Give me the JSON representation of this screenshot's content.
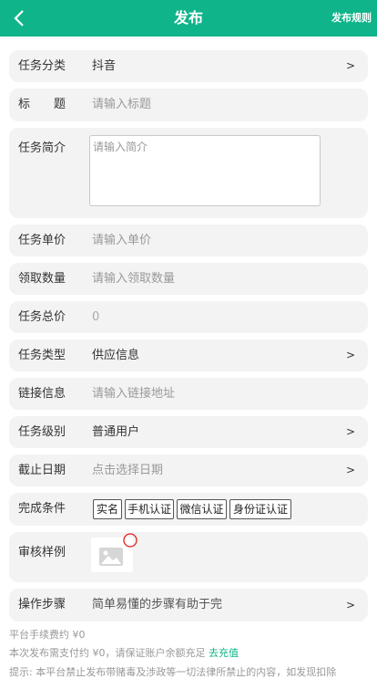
{
  "header": {
    "title": "发布",
    "rules_label": "发布规则"
  },
  "form": {
    "category": {
      "label": "任务分类",
      "value": "抖音",
      "arrow": ">"
    },
    "title": {
      "label": "标　　题",
      "placeholder": "请输入标题"
    },
    "intro": {
      "label": "任务简介",
      "placeholder": "请输入简介"
    },
    "unit_price": {
      "label": "任务单价",
      "placeholder": "请输入单价"
    },
    "quantity": {
      "label": "领取数量",
      "placeholder": "请输入领取数量"
    },
    "total": {
      "label": "任务总价",
      "value": "0"
    },
    "type": {
      "label": "任务类型",
      "value": "供应信息",
      "arrow": ">"
    },
    "link": {
      "label": "链接信息",
      "placeholder": "请输入链接地址"
    },
    "level": {
      "label": "任务级别",
      "value": "普通用户",
      "arrow": ">"
    },
    "deadline": {
      "label": "截止日期",
      "placeholder": "点击选择日期",
      "arrow": ">"
    },
    "conditions": {
      "label": "完成条件",
      "tags": [
        "实名",
        "手机认证",
        "微信认证",
        "身份证认证"
      ]
    },
    "sample": {
      "label": "审核样例"
    },
    "steps": {
      "label": "操作步骤",
      "placeholder": "简单易懂的步骤有助于完",
      "arrow": ">"
    }
  },
  "footer": {
    "fee": "平台手续费约 ¥0",
    "pay_text": "本次发布需支付约 ¥0，请保证账户余额充足 ",
    "recharge_link": "去充值",
    "tip": "提示: 本平台禁止发布带赌毒及涉政等一切法律所禁止的内容，如发现扣除"
  },
  "colors": {
    "brand": "#10b48a",
    "row_bg": "#f3f3f3"
  }
}
